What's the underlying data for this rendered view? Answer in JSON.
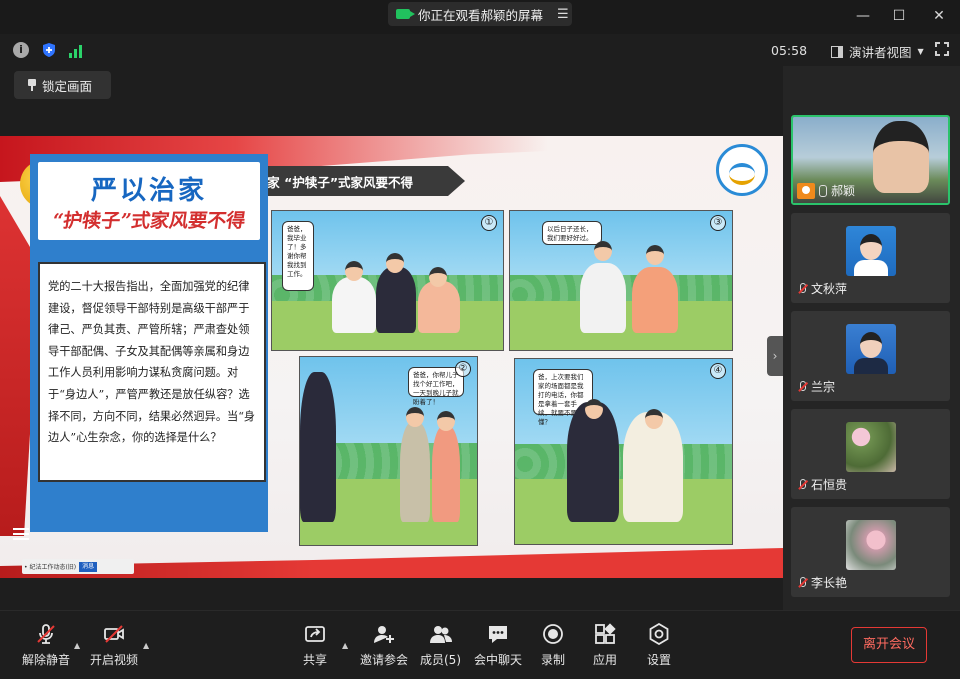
{
  "titlebar": {
    "watching_label": "你正在观看郝颖的屏幕"
  },
  "toolbar": {
    "timer": "05:58",
    "view_mode": "演讲者视图"
  },
  "lock_button": "锁定画面",
  "slide": {
    "banner": "纪法小课·管好身边人丨严以治家 “护犊子”式家风要不得",
    "big_title": "严以治家",
    "sub_title": "“护犊子”式家风要不得",
    "body_text": "党的二十大报告指出，全面加强党的纪律建设，督促领导干部特别是高级干部严于律己、严负其责、严管所辖；严肃查处领导干部配偶、子女及其配偶等亲属和身边工作人员利用影响力谋私贪腐问题。对于“身边人”，严管严教还是放任纵容？选择不同，方向不同，结果必然迥异。当“身边人”心生杂念，你的选择是什么？",
    "comics": [
      {
        "num": "①",
        "bubble": "爸爸，我毕业了！多谢你帮我找到工作。"
      },
      {
        "num": "③",
        "bubble": "以后日子还长，我们要好好过。"
      },
      {
        "num": "②",
        "bubble": "爸爸，你帮儿子找个好工作吧，一天到晚儿子就盼着了！"
      },
      {
        "num": "④",
        "bubble": "爸，上次要我们家的场面都是我打的电话，你都是拿着一套手续，就要不要懂？"
      }
    ],
    "taskbar": {
      "item1": "• 纪法工作动态(旧)",
      "item2": "消息"
    }
  },
  "participants": [
    {
      "name": "郝颖",
      "active": true,
      "muted": false,
      "host": true
    },
    {
      "name": "文秋萍",
      "active": false,
      "muted": true,
      "host": false
    },
    {
      "name": "兰宗",
      "active": false,
      "muted": true,
      "host": false
    },
    {
      "name": "石恒贵",
      "active": false,
      "muted": true,
      "host": false
    },
    {
      "name": "李长艳",
      "active": false,
      "muted": true,
      "host": false
    }
  ],
  "bottombar": {
    "unmute": "解除静音",
    "start_video": "开启视频",
    "share": "共享",
    "invite": "邀请参会",
    "members": "成员(5)",
    "chat": "会中聊天",
    "record": "录制",
    "apps": "应用",
    "settings": "设置",
    "leave": "离开会议"
  },
  "colors": {
    "accent_green": "#2bc36b",
    "leave_red": "#e53935",
    "host_orange": "#ef8a1c",
    "slide_blue": "#2f7fcc",
    "title_red": "#d32f2f"
  }
}
